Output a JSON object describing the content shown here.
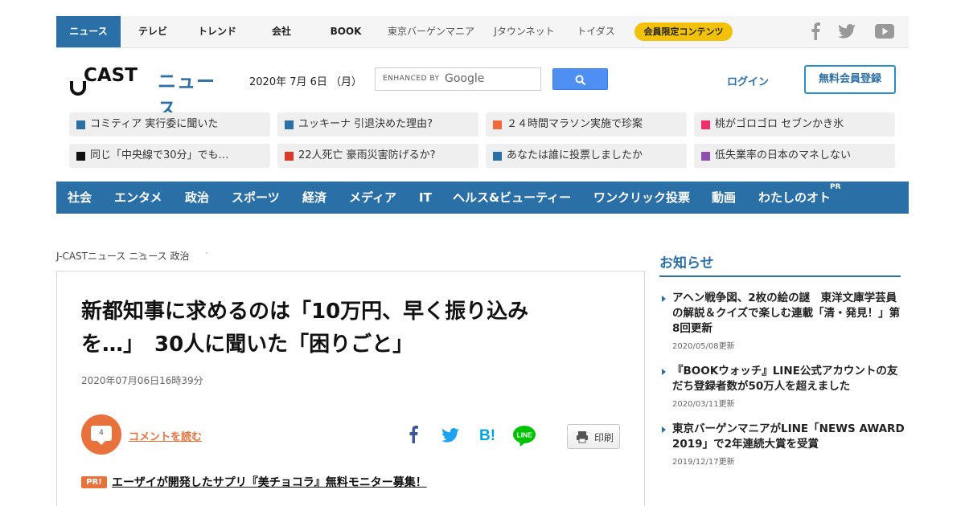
{
  "topnav": {
    "items": [
      "ニュース",
      "テレビ",
      "トレンド",
      "会社",
      "BOOK"
    ],
    "sub_items": [
      "東京バーゲンマニア",
      "Jタウンネット",
      "トイダス"
    ],
    "member_pill": "会員限定コンテンツ",
    "social": [
      "facebook-icon",
      "twitter-icon",
      "youtube-icon"
    ]
  },
  "header": {
    "logo_left": "CAST",
    "logo_right": "ニュース",
    "date": "2020年 7月 6日 （月）",
    "search": {
      "enhanced_by": "ENHANCED BY",
      "google": "Google"
    },
    "login": "ログイン",
    "register": "無料会員登録"
  },
  "topics": [
    {
      "label": "コミティア 実行委に聞いた",
      "color": "#2a6fa6"
    },
    {
      "label": "ユッキーナ 引退決めた理由?",
      "color": "#2a6fa6"
    },
    {
      "label": "２４時間マラソン実施で珍案",
      "color": "#f06a3c"
    },
    {
      "label": "桃がゴロゴロ セブンかき氷",
      "color": "#ee2f6b"
    },
    {
      "label": "同じ「中央線で30分」でも…",
      "color": "#111111"
    },
    {
      "label": "22人死亡 豪雨災害防げるか?",
      "color": "#d8392a"
    },
    {
      "label": "あなたは誰に投票しましたか",
      "color": "#2a6fa6"
    },
    {
      "label": "低失業率の日本のマネしない",
      "color": "#8e4fb0"
    }
  ],
  "catnav": {
    "items": [
      "社会",
      "エンタメ",
      "政治",
      "スポーツ",
      "経済",
      "メディア",
      "IT",
      "ヘルス&ビューティー",
      "ワンクリック投票",
      "動画",
      "わたしのオト"
    ],
    "pr_mark": "PR"
  },
  "breadcrumb": [
    "J-CASTニュース",
    "ニュース",
    "政治"
  ],
  "article": {
    "headline_line1": "新都知事に求めるのは「10万円、早く振り込み",
    "headline_line2": "を…」　30人に聞いた「困りごと」",
    "date": "2020年07月06日16時39分",
    "comment_count": "4",
    "comment_link": "コメントを読む",
    "print": "印刷",
    "pr_badge": "PR!",
    "pr_link": "エーザイが開発したサプリ『美チョコラ』無料モニター募集！"
  },
  "sidebar": {
    "title": "お知らせ",
    "notices": [
      {
        "text": "アヘン戦争図、2枚の絵の謎　東洋文庫学芸員の解説＆クイズで楽しむ連載「清・発見！」第8回更新",
        "date": "2020/05/08更新"
      },
      {
        "text": "『BOOKウォッチ』LINE公式アカウントの友だち登録者数が50万人を超えました",
        "date": "2020/03/11更新"
      },
      {
        "text": "東京バーゲンマニアがLINE「NEWS AWARD 2019」で2年連続大賞を受賞",
        "date": "2019/12/17更新"
      }
    ]
  },
  "colors": {
    "brand_blue": "#2a6fa6",
    "accent_orange": "#e8713c",
    "pill_yellow": "#f2c20b"
  }
}
